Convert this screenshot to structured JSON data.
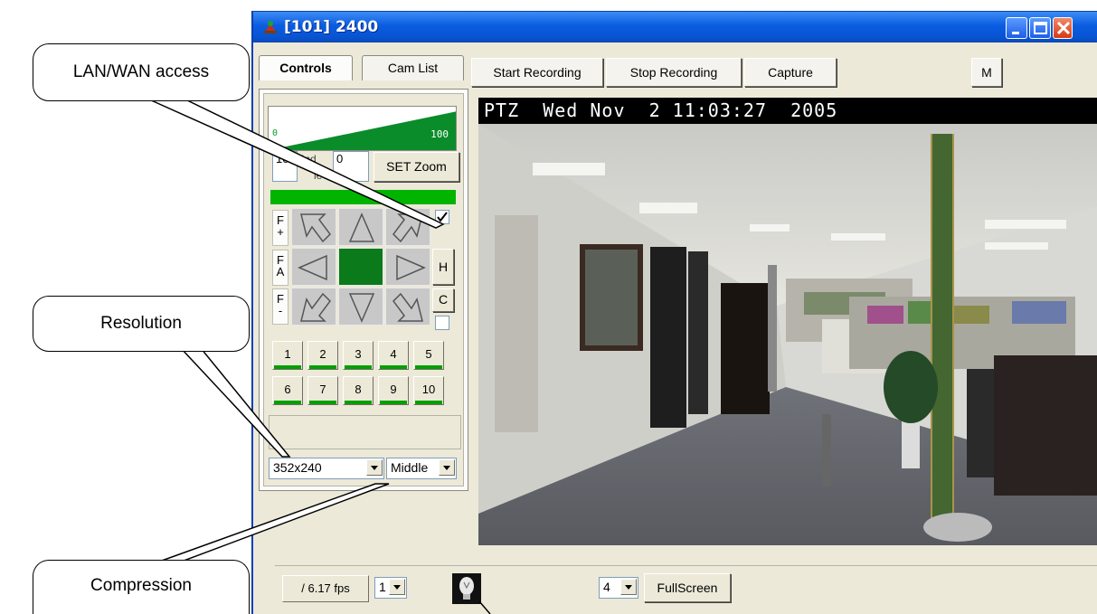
{
  "window": {
    "title": "[101] 2400",
    "title_icon": "camera-app-icon",
    "buttons": [
      "minimize-icon",
      "maximize-icon",
      "close-icon"
    ]
  },
  "tabs": [
    {
      "label": "Controls",
      "active": true
    },
    {
      "label": "Cam List",
      "active": false
    }
  ],
  "toolbar": {
    "start_recording": "Start Recording",
    "stop_recording": "Stop Recording",
    "capture": "Capture",
    "m": "M"
  },
  "controls": {
    "zoom_min": "0",
    "zoom_max": "100",
    "zoom_value_left": "10",
    "zoom_value_right": "0",
    "zoom_hidden_label": "Ind",
    "zoom_hidden_label2": "le",
    "set_zoom": "SET Zoom",
    "focus_plus_top": "F",
    "focus_plus_bottom": "+",
    "focus_auto_top": "F",
    "focus_auto_bottom": "A",
    "focus_minus_top": "F",
    "focus_minus_bottom": "-",
    "h_button": "H",
    "c_button": "C",
    "checkbox_checked": true,
    "presets": [
      "1",
      "2",
      "3",
      "4",
      "5",
      "6",
      "7",
      "8",
      "9",
      "10"
    ],
    "resolution": "352x240",
    "compression": "Middle"
  },
  "video": {
    "osd": "PTZ  Wed Nov  2 11:03:27  2005"
  },
  "bottom": {
    "fps": "/ 6.17 fps",
    "fps_select": "1",
    "layout_select": "4",
    "fullscreen": "FullScreen",
    "bulb_icon": "lightbulb-icon"
  },
  "callouts": {
    "lan_wan": "LAN/WAN access",
    "resolution": "Resolution",
    "compression": "Compression"
  },
  "colors": {
    "titlebar": "#0a5ce0",
    "zoom_fill": "#0a8c2a",
    "status_green": "#00b400"
  }
}
